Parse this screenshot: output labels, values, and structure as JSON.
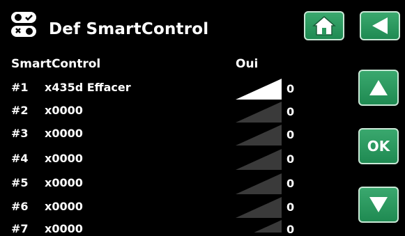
{
  "header": {
    "title": "Def SmartControl"
  },
  "columns": {
    "name": "SmartControl",
    "state": "Oui"
  },
  "buttons": {
    "ok_label": "OK"
  },
  "rows": [
    {
      "num": "#1",
      "name": "x435d Effacer",
      "value": "0",
      "active": true
    },
    {
      "num": "#2",
      "name": "x0000",
      "value": "0",
      "active": false
    },
    {
      "num": "#3",
      "name": "x0000",
      "value": "0",
      "active": false
    },
    {
      "num": "#4",
      "name": "x0000",
      "value": "0",
      "active": false
    },
    {
      "num": "#5",
      "name": "x0000",
      "value": "0",
      "active": false
    },
    {
      "num": "#6",
      "name": "x0000",
      "value": "0",
      "active": false
    },
    {
      "num": "#7",
      "name": "x0000",
      "value": "0",
      "active": false
    }
  ],
  "colors": {
    "accent": "#2a9a5f",
    "ramp_active": "#ffffff",
    "ramp_inactive": "#3a3a3a"
  },
  "icons": [
    "toggle-switches-icon",
    "home-icon",
    "back-arrow-icon",
    "up-arrow-icon",
    "down-arrow-icon"
  ]
}
